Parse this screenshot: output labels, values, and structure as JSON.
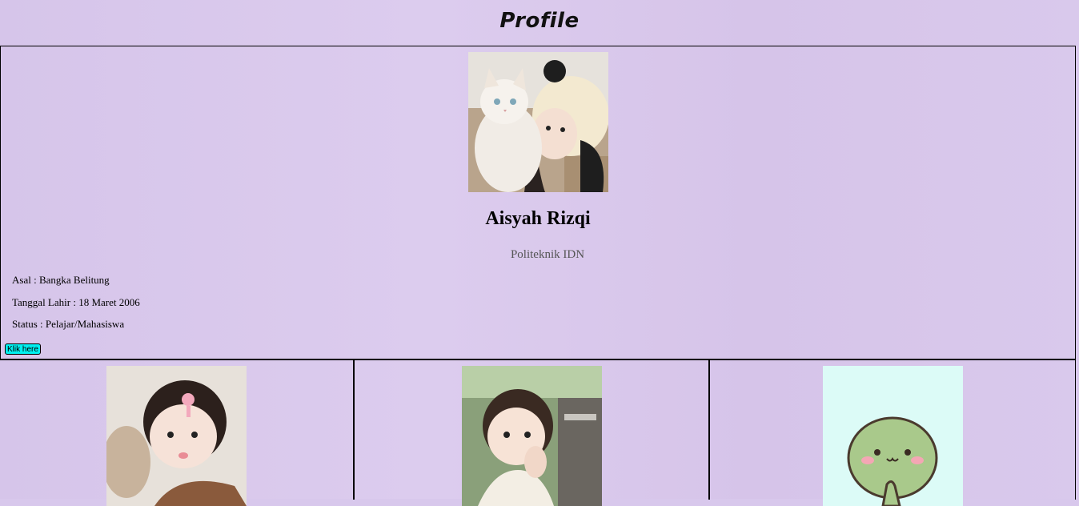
{
  "header": {
    "title": "Profile"
  },
  "profile": {
    "name": "Aisyah Rizqi",
    "institution": "Politeknik IDN",
    "info": [
      "Asal : Bangka Belitung",
      "Tanggal Lahir : 18 Maret 2006",
      "Status : Pelajar/Mahasiswa"
    ],
    "button_label": "Klik here",
    "photo": "girl-with-white-cat-photo"
  },
  "gallery": {
    "images": [
      "girl-with-hair-clip-photo",
      "girl-waving-on-train-photo",
      "green-turtle-cartoon-image"
    ]
  },
  "colors": {
    "background": "#d8c8ec",
    "button": "#00f0f0",
    "border": "#000000",
    "institution_text": "#555555"
  }
}
